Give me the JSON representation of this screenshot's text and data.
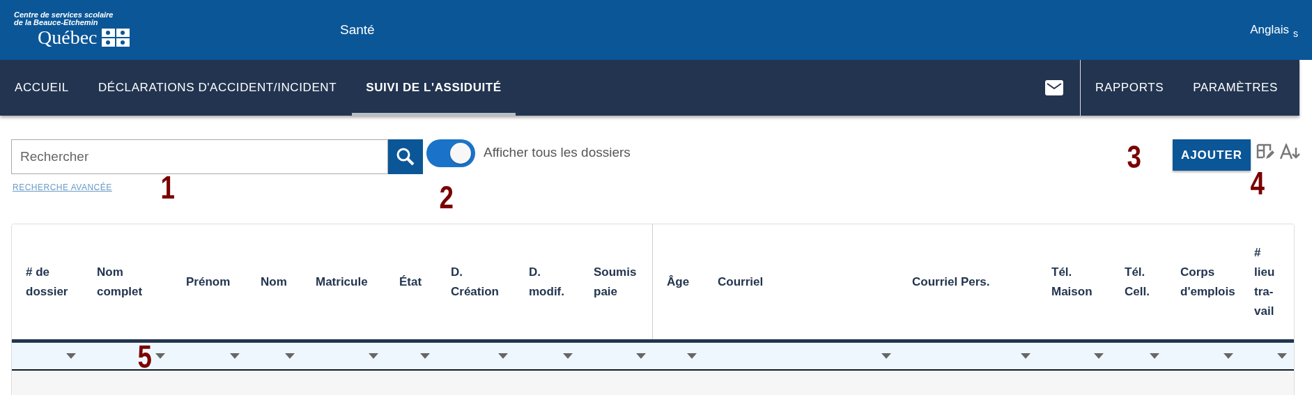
{
  "header": {
    "logo_text": "Centre de services scolaire de la Beauce-Etchemin",
    "logo_wordmark": "Québec",
    "app_title": "Santé",
    "language_link": "Anglais",
    "language_fragment": "s"
  },
  "nav": {
    "tabs": [
      {
        "label": "ACCUEIL",
        "selected": false
      },
      {
        "label": "DÉCLARATIONS D'ACCIDENT/INCIDENT",
        "selected": false
      },
      {
        "label": "SUIVI DE L'ASSIDUITÉ",
        "selected": true
      }
    ],
    "right_links": [
      "RAPPORTS",
      "PARAMÈTRES"
    ]
  },
  "toolbar": {
    "search": {
      "placeholder": "Rechercher"
    },
    "advanced_search": "RECHERCHE AVANCÉE",
    "show_all": {
      "label": "Afficher tous les dossiers",
      "on": true
    },
    "add_button": "AJOUTER"
  },
  "table": {
    "columns": [
      {
        "label": "# de dossier"
      },
      {
        "label": "Nom complet"
      },
      {
        "label": "Prénom"
      },
      {
        "label": "Nom"
      },
      {
        "label": "Matricule"
      },
      {
        "label": "État"
      },
      {
        "label": "D. Création"
      },
      {
        "label": "D. modif."
      },
      {
        "label": "Soumis paie"
      },
      {
        "label": "Âge"
      },
      {
        "label": "Courriel"
      },
      {
        "label": "Courriel Pers."
      },
      {
        "label": "Tél. Maison"
      },
      {
        "label": "Tél. Cell."
      },
      {
        "label": "Corps d'emplois"
      },
      {
        "label": "# lieu tra-vail"
      }
    ]
  },
  "callouts": [
    "1",
    "2",
    "3",
    "4",
    "5"
  ]
}
